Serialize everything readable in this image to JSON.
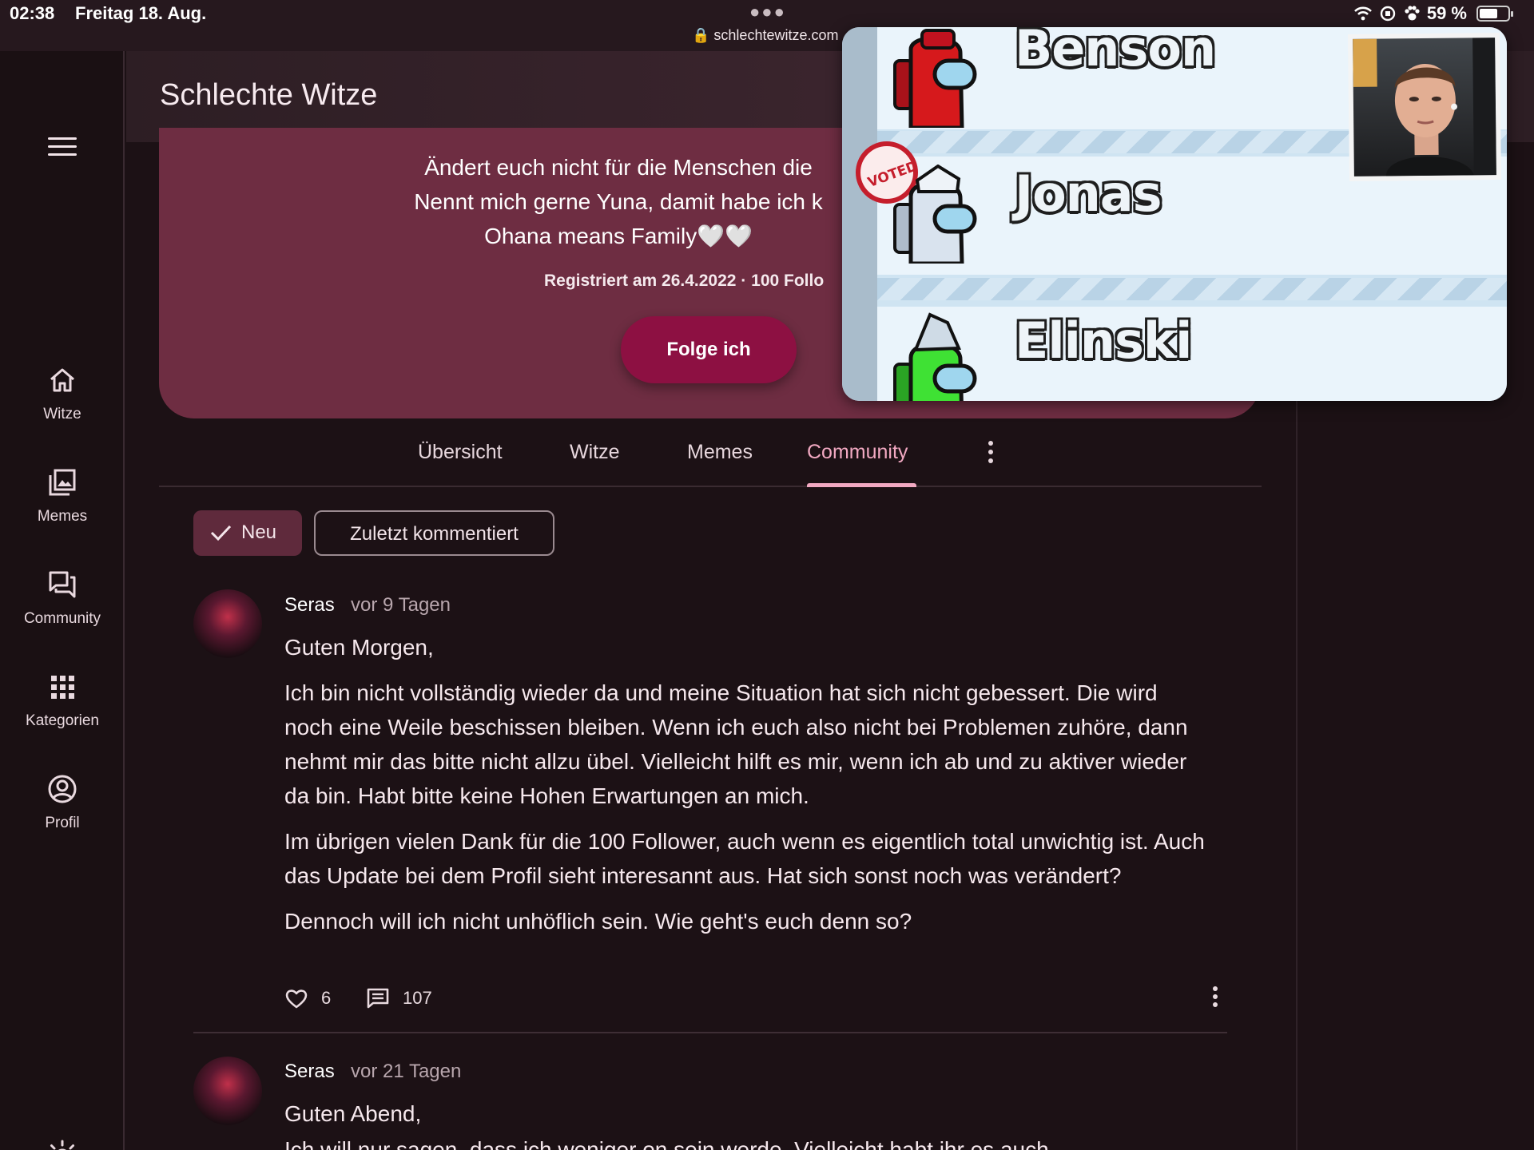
{
  "status_bar": {
    "time": "02:38",
    "date": "Freitag 18. Aug.",
    "url": "schlechtewitze.com",
    "battery": "59 %"
  },
  "sidebar": {
    "items": [
      {
        "label": "Witze",
        "icon": "home-icon"
      },
      {
        "label": "Memes",
        "icon": "image-gallery-icon"
      },
      {
        "label": "Community",
        "icon": "forum-icon"
      },
      {
        "label": "Kategorien",
        "icon": "apps-grid-icon"
      },
      {
        "label": "Profil",
        "icon": "account-circle-icon"
      }
    ]
  },
  "header": {
    "title": "Schlechte Witze"
  },
  "profile": {
    "bio_lines": [
      "Ändert euch nicht für die Menschen die",
      "Nennt mich gerne Yuna, damit habe ich k",
      "Ohana means Family🤍🤍"
    ],
    "registered": "Registriert am 26.4.2022 · 100 Follo",
    "follow_button": "Folge ich"
  },
  "tabs": [
    {
      "label": "Übersicht",
      "active": false
    },
    {
      "label": "Witze",
      "active": false
    },
    {
      "label": "Memes",
      "active": false
    },
    {
      "label": "Community",
      "active": true
    }
  ],
  "filters": {
    "new": "Neu",
    "recent": "Zuletzt kommentiert"
  },
  "posts": [
    {
      "author": "Seras",
      "time": "vor 9 Tagen",
      "greeting": "Guten Morgen,",
      "paragraphs": [
        "Ich bin nicht vollständig wieder da und meine Situation hat sich nicht gebessert. Die wird noch eine Weile beschissen bleiben. Wenn ich euch also nicht bei Problemen zuhöre, dann nehmt mir das bitte nicht allzu übel. Vielleicht hilft es mir, wenn ich ab und zu aktiver wieder da bin. Habt bitte keine Hohen Erwartungen an mich.",
        "Im übrigen vielen Dank für die 100 Follower, auch wenn es eigentlich total unwichtig ist. Auch das Update bei dem Profil sieht interesannt aus. Hat sich sonst noch was verändert?",
        "Dennoch will ich nicht unhöflich sein. Wie geht's euch denn so?"
      ],
      "likes": "6",
      "comments": "107"
    },
    {
      "author": "Seras",
      "time": "vor 21 Tagen",
      "greeting": "Guten Abend,",
      "paragraphs": [
        "Ich will nur sagen, dass ich weniger on sein werde. Vielleicht habt ihr es auch"
      ]
    }
  ],
  "pip": {
    "players": [
      "Benson",
      "Jonas",
      "Elinski"
    ],
    "badge": "I VOTED",
    "colors": {
      "red": "#d6191c",
      "white": "#d9e3ee",
      "lime": "#3fe134"
    }
  },
  "colors": {
    "background": "#1c1115",
    "card": "#6e2d42",
    "accent": "#8d1042",
    "tab_active": "#f2a9c2"
  }
}
